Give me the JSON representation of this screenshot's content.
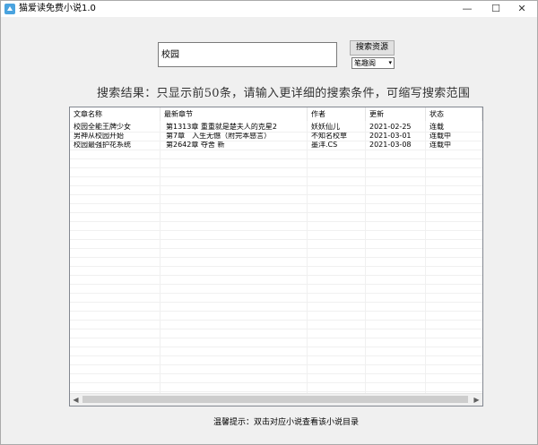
{
  "window": {
    "title": "猫爱读免费小说1.0",
    "minimize": "—",
    "maximize": "☐",
    "close": "✕"
  },
  "search": {
    "value": "校园",
    "button_label": "搜索资源",
    "source_selected": "笔趣阁"
  },
  "result_info": "搜索结果：只显示前50条，请输入更详细的搜索条件，可缩写搜索范围",
  "table": {
    "columns": [
      "文章名称",
      "最新章节",
      "作者",
      "更新",
      "状态"
    ],
    "rows": [
      [
        "校园全能王牌少女",
        "第1313章 重重就是楚夫人的克星2",
        "妖妖仙儿",
        "2021-02-25",
        "连载"
      ],
      [
        "男神从校园开始",
        "第7章　入生无憾（附完本感言）",
        "不知名校草",
        "2021-03-01",
        "连载中"
      ],
      [
        "校园最强护花系统",
        "第2642章 夺舍 新",
        "墨洋.CS",
        "2021-03-08",
        "连载中"
      ]
    ]
  },
  "tip": "温馨提示：双击对应小说查看该小说目录"
}
